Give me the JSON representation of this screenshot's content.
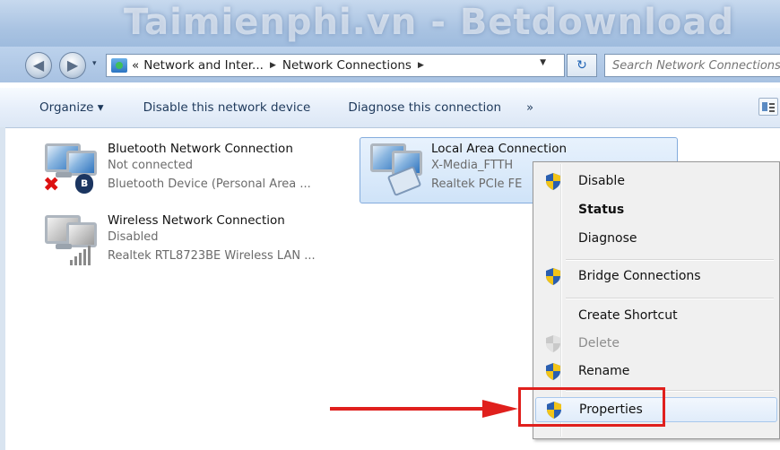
{
  "watermark": "Taimienphi.vn - Betdownload",
  "nav": {
    "back_glyph": "◀",
    "forward_glyph": "▶",
    "dropdown_glyph": "▾"
  },
  "address": {
    "overflow": "«",
    "crumbs": [
      "Network and Inter...",
      "Network Connections"
    ],
    "sep": "▶",
    "drop": "▼",
    "refresh_glyph": "↻"
  },
  "search": {
    "placeholder": "Search Network Connections"
  },
  "toolbar": {
    "organize": "Organize ▾",
    "disable": "Disable this network device",
    "diagnose": "Diagnose this connection",
    "more": "»"
  },
  "connections": [
    {
      "name": "Bluetooth Network Connection",
      "status": "Not connected",
      "device": "Bluetooth Device (Personal Area ..."
    },
    {
      "name": "Wireless Network Connection",
      "status": "Disabled",
      "device": "Realtek RTL8723BE Wireless LAN ..."
    },
    {
      "name": "Local Area Connection",
      "status": "X-Media_FTTH",
      "device": "Realtek PCIe FE"
    }
  ],
  "icons": {
    "bluetooth_glyph": "ʙ",
    "x_glyph": "✖"
  },
  "context_menu": {
    "items": [
      "Disable",
      "Status",
      "Diagnose",
      "Bridge Connections",
      "Create Shortcut",
      "Delete",
      "Rename",
      "Properties"
    ]
  },
  "colors": {
    "highlight": "#e0201d",
    "selection": "#cfe3f8",
    "shield_blue": "#2a5fb0",
    "shield_yellow": "#f2c418"
  }
}
